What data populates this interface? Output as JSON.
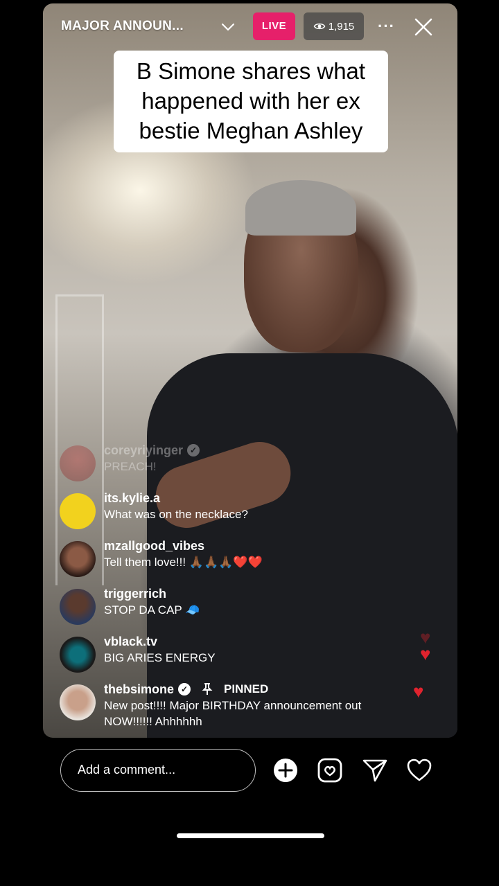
{
  "stream": {
    "title": "MAJOR ANNOUN...",
    "live_label": "LIVE",
    "viewer_count": "1,915",
    "more_label": "···"
  },
  "caption": {
    "line1": "B Simone shares what",
    "line2": "happened with her ex",
    "line3": "bestie Meghan Ashley"
  },
  "comments": [
    {
      "user": "coreyriyinger",
      "message": "PREACH!",
      "faded": true,
      "verified": true
    },
    {
      "user": "its.kylie.a",
      "message": "What was on the necklace?"
    },
    {
      "user": "mzallgood_vibes",
      "message": "Tell them love!!! 🙏🏾🙏🏾🙏🏾❤️❤️"
    },
    {
      "user": "triggerrich",
      "message": "STOP DA CAP 🧢"
    },
    {
      "user": "vblack.tv",
      "message": "BIG ARIES ENERGY"
    },
    {
      "user": "thebsimone",
      "verified": true,
      "pinned_label": "PINNED",
      "message_line1": "New post!!!! Major BIRTHDAY announcement out",
      "message_line2": "NOW!!!!!! Ahhhhhh"
    }
  ],
  "composer": {
    "placeholder": "Add a comment..."
  },
  "colors": {
    "live_badge": "#e6206a",
    "heart": "#e0232e",
    "kylie_avatar": "#f2d21e"
  },
  "icons": [
    "chevron-down-icon",
    "eye-icon",
    "more-icon",
    "close-icon",
    "verified-icon",
    "pin-icon",
    "add-icon",
    "instagram-icon",
    "send-icon",
    "heart-icon"
  ]
}
